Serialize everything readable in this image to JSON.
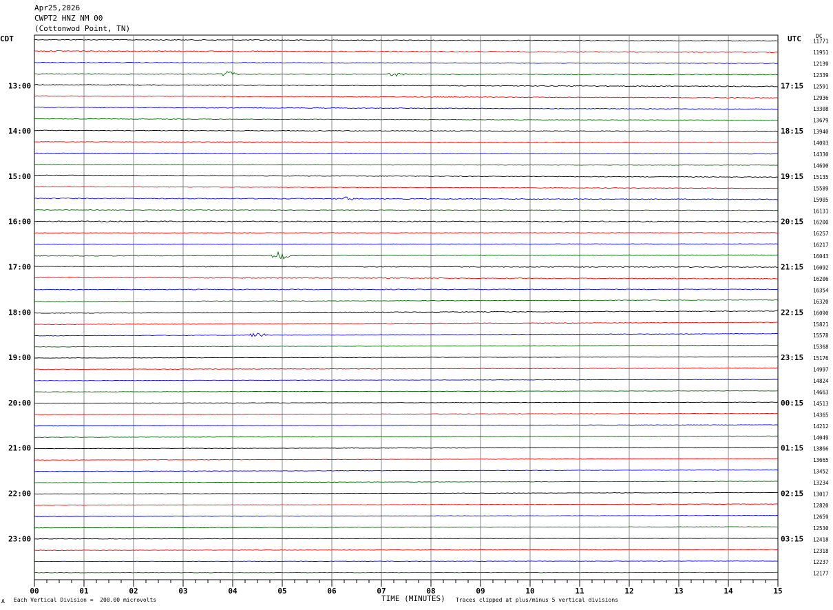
{
  "header": {
    "date": "Apr25,2026",
    "station": "CWPT2 HNZ NM 00",
    "location": "(Cottonwod Point, TN)"
  },
  "left_tz": "CDT",
  "right_tz": "UTC",
  "dc_label": "DC",
  "footer": {
    "corner_mark": "A",
    "scale": "Each Vertical Division =  200.00 microvolts",
    "clip": "Traces clipped at plus/minus 5 vertical divisions"
  },
  "chart_data": {
    "type": "line",
    "title": "",
    "xlabel": "TIME (MINUTES)",
    "xlim": [
      0,
      15
    ],
    "x_ticks": [
      "00",
      "01",
      "02",
      "03",
      "04",
      "05",
      "06",
      "07",
      "08",
      "09",
      "10",
      "11",
      "12",
      "13",
      "14",
      "15"
    ],
    "grid": true,
    "trace_colors": [
      "#000000",
      "#ff0000",
      "#0000ff",
      "#006600"
    ],
    "left_hour_labels": [
      "13:00",
      "14:00",
      "15:00",
      "16:00",
      "17:00",
      "18:00",
      "19:00",
      "20:00",
      "21:00",
      "22:00",
      "23:00"
    ],
    "right_hour_labels": [
      "17:15",
      "18:15",
      "19:15",
      "20:15",
      "21:15",
      "22:15",
      "23:15",
      "00:15",
      "01:15",
      "02:15",
      "03:15"
    ],
    "first_labelled_row": 4,
    "dc_values": [
      11771,
      11951,
      12139,
      12339,
      12591,
      12936,
      13308,
      13679,
      13940,
      14093,
      14330,
      14690,
      15135,
      15589,
      15905,
      16131,
      16200,
      16257,
      16217,
      16043,
      16092,
      16206,
      16354,
      16320,
      16090,
      15821,
      15578,
      15368,
      15176,
      14997,
      14824,
      14663,
      14513,
      14365,
      14212,
      14049,
      13866,
      13665,
      13452,
      13234,
      13017,
      12820,
      12659,
      12530,
      12418,
      12318,
      12237,
      12177
    ],
    "trace_drift": [
      0.6,
      0.6,
      0.4,
      0.3,
      0.8,
      0.9,
      0.9,
      0.7,
      0.4,
      0.4,
      0.3,
      0.3,
      0.9,
      0.8,
      0.5,
      0.2,
      0.1,
      -0.1,
      -0.2,
      -0.4,
      0.3,
      0.6,
      -0.1,
      -0.8,
      -1.0,
      -1.0,
      -1.0,
      -0.8,
      -0.6,
      -0.6,
      -0.6,
      -0.5,
      -0.5,
      -0.5,
      -0.5,
      -0.6,
      -0.6,
      -0.7,
      -0.7,
      -0.7,
      -0.7,
      -0.6,
      -0.5,
      -0.5,
      -0.3,
      -0.3,
      -0.2,
      -0.1
    ],
    "trace_noise": [
      0.3,
      0.35,
      0.25,
      0.3,
      0.3,
      0.25,
      0.25,
      0.2,
      0.25,
      0.2,
      0.2,
      0.2,
      0.25,
      0.2,
      0.3,
      0.2,
      0.35,
      0.2,
      0.2,
      0.25,
      0.3,
      0.3,
      0.25,
      0.2,
      0.25,
      0.2,
      0.2,
      0.15,
      0.15,
      0.2,
      0.15,
      0.15,
      0.15,
      0.15,
      0.15,
      0.15,
      0.15,
      0.15,
      0.15,
      0.15,
      0.15,
      0.15,
      0.15,
      0.15,
      0.15,
      0.15,
      0.15,
      0.15
    ],
    "events": [
      {
        "row": 3,
        "minute": 3.9,
        "amplitude": 0.6
      },
      {
        "row": 3,
        "minute": 7.3,
        "amplitude": 0.4
      },
      {
        "row": 14,
        "minute": 6.3,
        "amplitude": 0.4
      },
      {
        "row": 19,
        "minute": 4.95,
        "amplitude": 1.2
      },
      {
        "row": 26,
        "minute": 4.5,
        "amplitude": 0.6
      }
    ]
  }
}
